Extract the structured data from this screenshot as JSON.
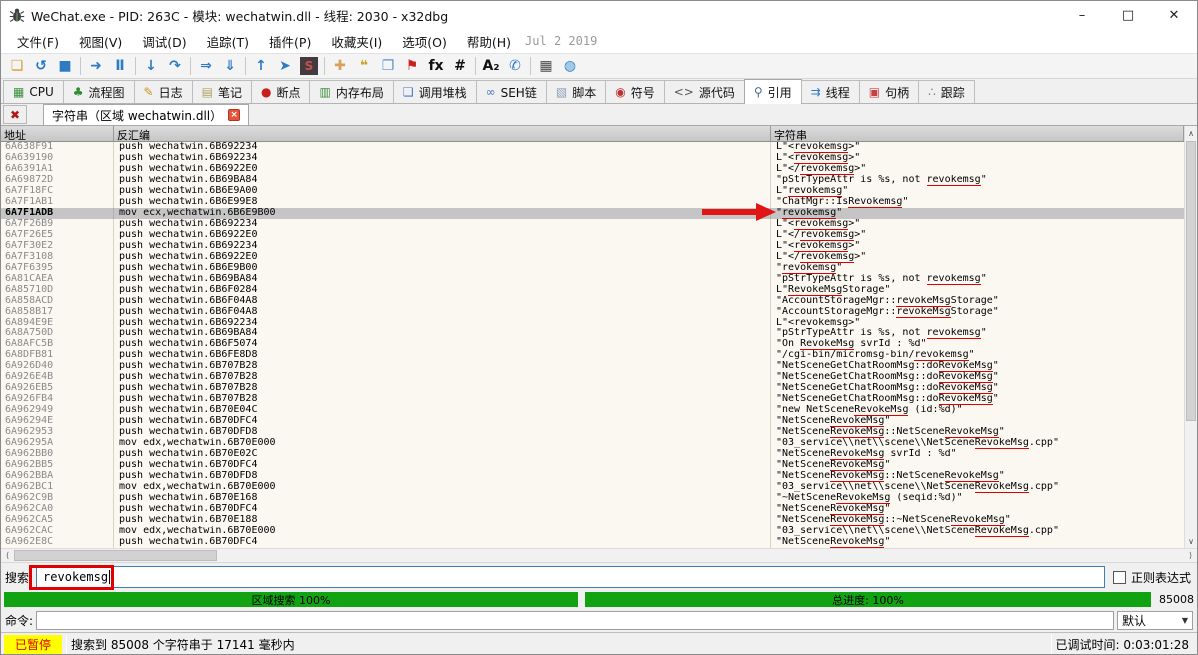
{
  "window": {
    "title": "WeChat.exe - PID: 263C - 模块: wechatwin.dll - 线程: 2030 - x32dbg",
    "minimize": "–",
    "maximize": "□",
    "close": "✕"
  },
  "menu": {
    "items": [
      "文件(F)",
      "视图(V)",
      "调试(D)",
      "追踪(T)",
      "插件(P)",
      "收藏夹(I)",
      "选项(O)",
      "帮助(H)"
    ],
    "build_date": "Jul 2 2019"
  },
  "toolbar": {
    "icons": [
      {
        "name": "open-file-icon",
        "glyph": "❏",
        "color": "#d79b3b"
      },
      {
        "name": "restart-icon",
        "glyph": "↺",
        "color": "#1e74c8"
      },
      {
        "name": "stop-icon",
        "glyph": "■",
        "color": "#2e7bc4"
      },
      {
        "name": "separator"
      },
      {
        "name": "run-icon",
        "glyph": "➜",
        "color": "#2e7bc4"
      },
      {
        "name": "pause-icon",
        "glyph": "Ⅱ",
        "color": "#2e7bc4"
      },
      {
        "name": "separator"
      },
      {
        "name": "step-into-icon",
        "glyph": "↓",
        "color": "#2e7bc4"
      },
      {
        "name": "step-over-icon",
        "glyph": "↷",
        "color": "#2e7bc4"
      },
      {
        "name": "separator"
      },
      {
        "name": "run-to-cursor-icon",
        "glyph": "⇒",
        "color": "#2e7bc4"
      },
      {
        "name": "step-out-icon",
        "glyph": "⇓",
        "color": "#2e7bc4"
      },
      {
        "name": "separator"
      },
      {
        "name": "run-to-user-code-icon",
        "glyph": "↑",
        "color": "#2e7bc4"
      },
      {
        "name": "attach-icon",
        "glyph": "➤",
        "color": "#2e7bc4"
      },
      {
        "name": "seh-badge-icon",
        "glyph": "S",
        "badge": true
      },
      {
        "name": "separator"
      },
      {
        "name": "patches-icon",
        "glyph": "✚",
        "color": "#d8a05a"
      },
      {
        "name": "comments-icon",
        "glyph": "❝",
        "color": "#c9a227"
      },
      {
        "name": "labels-icon",
        "glyph": "❐",
        "color": "#5a8fd3"
      },
      {
        "name": "bookmarks-icon",
        "glyph": "⚑",
        "color": "#cc2020"
      },
      {
        "name": "functions-icon",
        "glyph": "fx",
        "color": "#111111"
      },
      {
        "name": "hash-icon",
        "glyph": "#",
        "color": "#111111"
      },
      {
        "name": "separator"
      },
      {
        "name": "strings-icon",
        "glyph": "A₂",
        "color": "#111111"
      },
      {
        "name": "call-icon",
        "glyph": "✆",
        "color": "#2e7bc4"
      },
      {
        "name": "separator"
      },
      {
        "name": "calculator-icon",
        "glyph": "▦",
        "color": "#4a4a4a"
      },
      {
        "name": "globe-icon",
        "glyph": "◍",
        "color": "#2e86c8"
      }
    ]
  },
  "tabs": [
    {
      "label": "CPU",
      "icon": "cpu-icon",
      "glyph": "▦",
      "color": "#3e8e3e",
      "active": false
    },
    {
      "label": "流程图",
      "icon": "graph-icon",
      "glyph": "♣",
      "color": "#2e8b2e",
      "active": false
    },
    {
      "label": "日志",
      "icon": "log-icon",
      "glyph": "✎",
      "color": "#c99226",
      "active": false
    },
    {
      "label": "笔记",
      "icon": "notes-icon",
      "glyph": "▤",
      "color": "#b0a060",
      "active": false
    },
    {
      "label": "断点",
      "icon": "breakpoint-icon",
      "glyph": "●",
      "color": "#c81e1e",
      "active": false
    },
    {
      "label": "内存布局",
      "icon": "memory-map-icon",
      "glyph": "▥",
      "color": "#3e8e3e",
      "active": false
    },
    {
      "label": "调用堆栈",
      "icon": "call-stack-icon",
      "glyph": "❏",
      "color": "#4a78c8",
      "active": false
    },
    {
      "label": "SEH链",
      "icon": "seh-chain-icon",
      "glyph": "∞",
      "color": "#4a78c8",
      "active": false
    },
    {
      "label": "脚本",
      "icon": "script-icon",
      "glyph": "▧",
      "color": "#8aa0b8",
      "active": false
    },
    {
      "label": "符号",
      "icon": "symbols-icon",
      "glyph": "◉",
      "color": "#c03030",
      "active": false
    },
    {
      "label": "源代码",
      "icon": "source-icon",
      "glyph": "<>",
      "color": "#555555",
      "active": false
    },
    {
      "label": "引用",
      "icon": "references-icon",
      "glyph": "⚲",
      "color": "#4a6a8a",
      "active": true
    },
    {
      "label": "线程",
      "icon": "threads-icon",
      "glyph": "⇉",
      "color": "#2e7bc4",
      "active": false
    },
    {
      "label": "句柄",
      "icon": "handles-icon",
      "glyph": "▣",
      "color": "#c84040",
      "active": false
    },
    {
      "label": "跟踪",
      "icon": "trace-icon",
      "glyph": "∴",
      "color": "#777777",
      "active": false
    }
  ],
  "doc_tab": {
    "close_all": "✖",
    "label": "字符串（区域 wechatwin.dll）",
    "close": "×"
  },
  "table": {
    "columns": [
      "地址",
      "反汇编",
      "字符串"
    ],
    "highlight_term": "revokemsg",
    "selected_addr": "6A7F1ADB",
    "rows": [
      {
        "addr": "6A638F91",
        "disasm": "push wechatwin.6B692234",
        "str": "L\"<revokemsg>\""
      },
      {
        "addr": "6A639190",
        "disasm": "push wechatwin.6B692234",
        "str": "L\"<revokemsg>\""
      },
      {
        "addr": "6A6391A1",
        "disasm": "push wechatwin.6B6922E0",
        "str": "L\"</revokemsg>\""
      },
      {
        "addr": "6A69872D",
        "disasm": "push wechatwin.6B69BA84",
        "str": "\"pStrTypeAttr is %s, not revokemsg\""
      },
      {
        "addr": "6A7F18FC",
        "disasm": "push wechatwin.6B6E9A00",
        "str": "L\"revokemsg\""
      },
      {
        "addr": "6A7F1AB1",
        "disasm": "push wechatwin.6B6E99E8",
        "str": "\"ChatMgr::IsRevokemsg\""
      },
      {
        "addr": "6A7F1ADB",
        "disasm": "mov ecx,wechatwin.6B6E9B00",
        "str": "\"revokemsg\""
      },
      {
        "addr": "6A7F26B9",
        "disasm": "push wechatwin.6B692234",
        "str": "L\"<revokemsg>\""
      },
      {
        "addr": "6A7F26E5",
        "disasm": "push wechatwin.6B6922E0",
        "str": "L\"</revokemsg>\""
      },
      {
        "addr": "6A7F30E2",
        "disasm": "push wechatwin.6B692234",
        "str": "L\"<revokemsg>\""
      },
      {
        "addr": "6A7F3108",
        "disasm": "push wechatwin.6B6922E0",
        "str": "L\"</revokemsg>\""
      },
      {
        "addr": "6A7F6395",
        "disasm": "push wechatwin.6B6E9B00",
        "str": "\"revokemsg\""
      },
      {
        "addr": "6A81CAEA",
        "disasm": "push wechatwin.6B69BA84",
        "str": "\"pStrTypeAttr is %s, not revokemsg\""
      },
      {
        "addr": "6A85710D",
        "disasm": "push wechatwin.6B6F0284",
        "str": "L\"RevokeMsgStorage\""
      },
      {
        "addr": "6A858ACD",
        "disasm": "push wechatwin.6B6F04A8",
        "str": "\"AccountStorageMgr::revokeMsgStorage\""
      },
      {
        "addr": "6A858B17",
        "disasm": "push wechatwin.6B6F04A8",
        "str": "\"AccountStorageMgr::revokeMsgStorage\""
      },
      {
        "addr": "6A894E9E",
        "disasm": "push wechatwin.6B692234",
        "str": "L\"<revokemsg>\""
      },
      {
        "addr": "6A8A750D",
        "disasm": "push wechatwin.6B69BA84",
        "str": "\"pStrTypeAttr is %s, not revokemsg\""
      },
      {
        "addr": "6A8AFC5B",
        "disasm": "push wechatwin.6B6F5074",
        "str": "\"On RevokeMsg svrId : %d\""
      },
      {
        "addr": "6A8DFB81",
        "disasm": "push wechatwin.6B6FE8D8",
        "str": "\"/cgi-bin/micromsg-bin/revokemsg\""
      },
      {
        "addr": "6A926D40",
        "disasm": "push wechatwin.6B707B28",
        "str": "\"NetSceneGetChatRoomMsg::doRevokeMsg\""
      },
      {
        "addr": "6A926E4B",
        "disasm": "push wechatwin.6B707B28",
        "str": "\"NetSceneGetChatRoomMsg::doRevokeMsg\""
      },
      {
        "addr": "6A926EB5",
        "disasm": "push wechatwin.6B707B28",
        "str": "\"NetSceneGetChatRoomMsg::doRevokeMsg\""
      },
      {
        "addr": "6A926FB4",
        "disasm": "push wechatwin.6B707B28",
        "str": "\"NetSceneGetChatRoomMsg::doRevokeMsg\""
      },
      {
        "addr": "6A962949",
        "disasm": "push wechatwin.6B70E04C",
        "str": "\"new NetSceneRevokeMsg (id:%d)\""
      },
      {
        "addr": "6A96294E",
        "disasm": "push wechatwin.6B70DFC4",
        "str": "\"NetSceneRevokeMsg\""
      },
      {
        "addr": "6A962953",
        "disasm": "push wechatwin.6B70DFD8",
        "str": "\"NetSceneRevokeMsg::NetSceneRevokeMsg\""
      },
      {
        "addr": "6A96295A",
        "disasm": "mov edx,wechatwin.6B70E000",
        "str": "\"03_service\\\\net\\\\scene\\\\NetSceneRevokeMsg.cpp\""
      },
      {
        "addr": "6A962BB0",
        "disasm": "push wechatwin.6B70E02C",
        "str": "\"NetSceneRevokeMsg svrId : %d\""
      },
      {
        "addr": "6A962BB5",
        "disasm": "push wechatwin.6B70DFC4",
        "str": "\"NetSceneRevokeMsg\""
      },
      {
        "addr": "6A962BBA",
        "disasm": "push wechatwin.6B70DFD8",
        "str": "\"NetSceneRevokeMsg::NetSceneRevokeMsg\""
      },
      {
        "addr": "6A962BC1",
        "disasm": "mov edx,wechatwin.6B70E000",
        "str": "\"03_service\\\\net\\\\scene\\\\NetSceneRevokeMsg.cpp\""
      },
      {
        "addr": "6A962C9B",
        "disasm": "push wechatwin.6B70E168",
        "str": "\"~NetSceneRevokeMsg (seqid:%d)\""
      },
      {
        "addr": "6A962CA0",
        "disasm": "push wechatwin.6B70DFC4",
        "str": "\"NetSceneRevokeMsg\""
      },
      {
        "addr": "6A962CA5",
        "disasm": "push wechatwin.6B70E188",
        "str": "\"NetSceneRevokeMsg::~NetSceneRevokeMsg\""
      },
      {
        "addr": "6A962CAC",
        "disasm": "mov edx,wechatwin.6B70E000",
        "str": "\"03_service\\\\net\\\\scene\\\\NetSceneRevokeMsg.cpp\""
      },
      {
        "addr": "6A962E8C",
        "disasm": "push wechatwin.6B70DFC4",
        "str": "\"NetSceneRevokeMsg\""
      }
    ]
  },
  "search": {
    "label": "搜索:",
    "value": "revokemsg",
    "regex_label": "正则表达式",
    "regex_checked": false
  },
  "progress": {
    "region_label": "区域搜索  100%",
    "total_label": "总进度:  100%",
    "count": "85008",
    "bar_color": "#12a312"
  },
  "command": {
    "label": "命令:",
    "value": "",
    "profile": "默认"
  },
  "status": {
    "state": "已暂停",
    "message": "搜索到  85008  个字符串于  17141  毫秒内",
    "time_label": "已调试时间:",
    "time_value": "0:03:01:28"
  }
}
